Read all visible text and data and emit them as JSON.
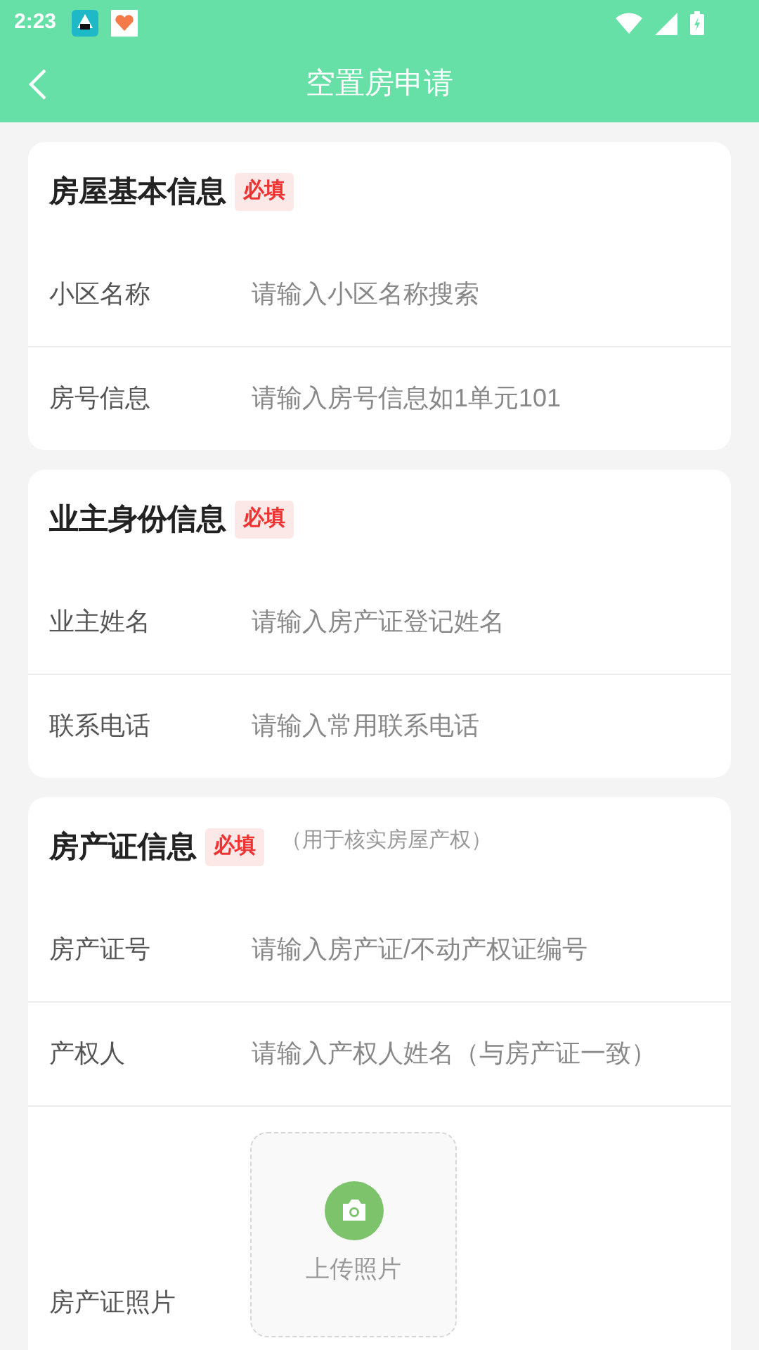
{
  "status_bar": {
    "time": "2:23"
  },
  "app_bar": {
    "title": "空置房申请"
  },
  "sections": [
    {
      "title": "房屋基本信息",
      "badge": "必填",
      "fields": [
        {
          "kind": "text",
          "label": "小区名称",
          "placeholder": "请输入小区名称搜索"
        },
        {
          "kind": "text",
          "label": "房号信息",
          "placeholder": "请输入房号信息如1单元101"
        }
      ]
    },
    {
      "title": "业主身份信息",
      "badge": "必填",
      "fields": [
        {
          "kind": "text",
          "label": "业主姓名",
          "placeholder": "请输入房产证登记姓名"
        },
        {
          "kind": "text",
          "label": "联系电话",
          "placeholder": "请输入常用联系电话"
        }
      ]
    },
    {
      "title": "房产证信息",
      "badge": "必填",
      "note": "（用于核实房屋产权）",
      "fields": [
        {
          "kind": "text",
          "label": "房产证号",
          "placeholder": "请输入房产证/不动产权证编号"
        },
        {
          "kind": "text",
          "label": "产权人",
          "placeholder": "请输入产权人姓名（与房产证一致）"
        },
        {
          "kind": "photo",
          "label": "房产证照片",
          "button_label": "上传照片"
        }
      ]
    }
  ]
}
